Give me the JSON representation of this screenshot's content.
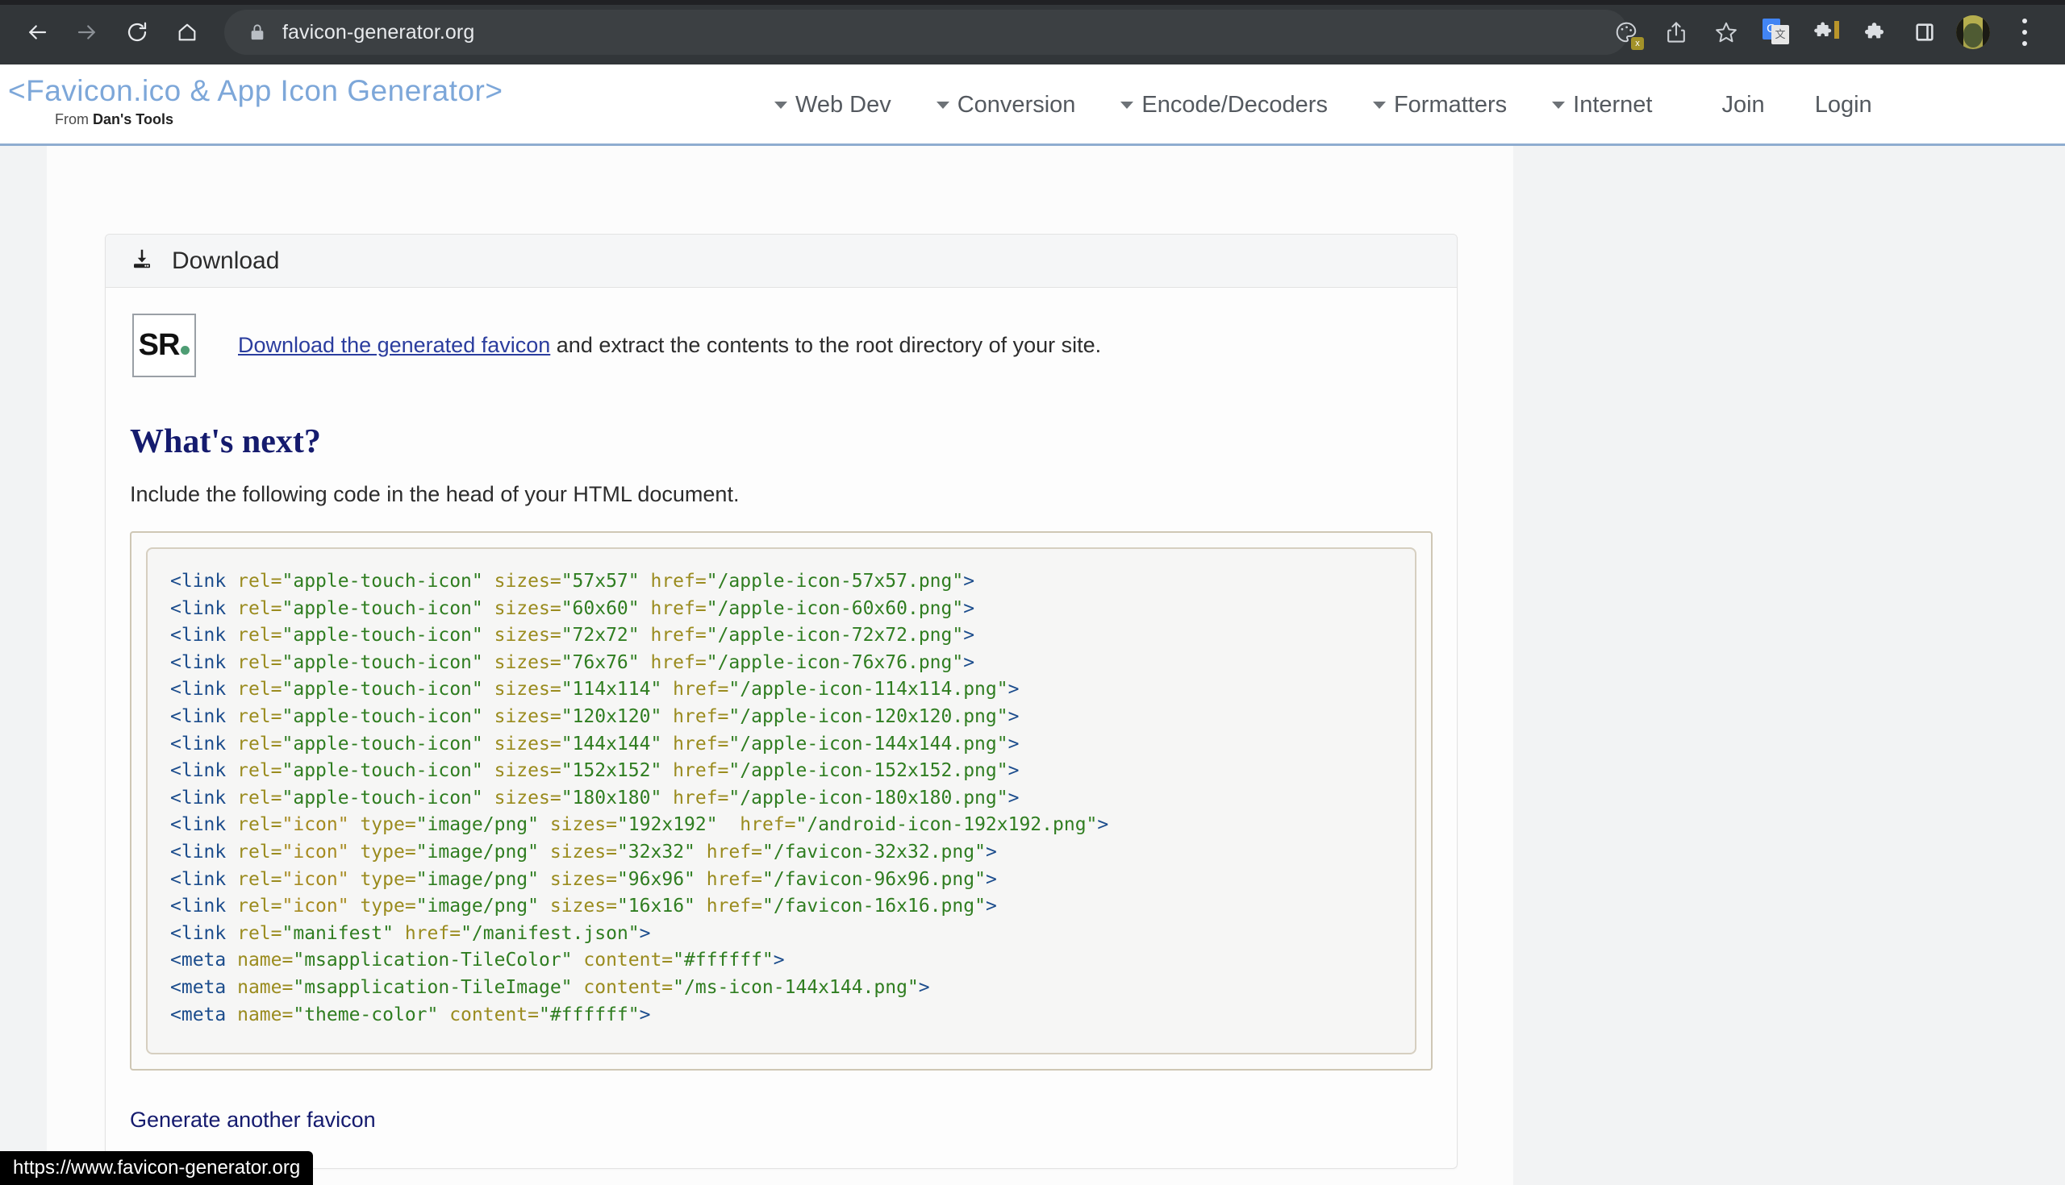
{
  "browser": {
    "url": "favicon-generator.org",
    "back_icon": "back-arrow-icon",
    "forward_icon": "forward-arrow-icon",
    "reload_icon": "reload-icon",
    "home_icon": "home-icon",
    "lock_icon": "lock-icon",
    "actions": [
      "palette-icon",
      "share-icon",
      "bookmark-star-icon",
      "google-translate-icon",
      "extension-puzzle-icon",
      "puzzle-icon",
      "side-panel-icon",
      "avatar",
      "three-dot-menu-icon"
    ]
  },
  "site": {
    "brand_title": "<Favicon.ico & App Icon Generator>",
    "brand_sub_prefix": "From ",
    "brand_sub_strong": "Dan's Tools",
    "nav": [
      {
        "label": "Web Dev",
        "caret": true
      },
      {
        "label": "Conversion",
        "caret": true
      },
      {
        "label": "Encode/Decoders",
        "caret": true
      },
      {
        "label": "Formatters",
        "caret": true
      },
      {
        "label": "Internet",
        "caret": true
      },
      {
        "label": "Join",
        "caret": false
      },
      {
        "label": "Login",
        "caret": false
      }
    ]
  },
  "panel": {
    "header_title": "Download",
    "header_icon": "download-icon",
    "favicon_letters": "SR",
    "download_link_text": "Download the generated favicon",
    "download_rest_text": " and extract the contents to the root directory of your site.",
    "whats_next_heading": "What's next?",
    "include_text": "Include the following code in the head of your HTML document.",
    "generate_another": "Generate another favicon",
    "accent_green": "#4e9d74",
    "link_color": "#2b3d9e"
  },
  "code": {
    "lines": [
      [
        [
          "<link",
          "tag"
        ],
        [
          " rel=",
          "attr"
        ],
        [
          "\"apple-touch-icon\"",
          "val"
        ],
        [
          " sizes=",
          "attr"
        ],
        [
          "\"57x57\"",
          "val"
        ],
        [
          " href=",
          "attr"
        ],
        [
          "\"/apple-icon-57x57.png\"",
          "val"
        ],
        [
          ">",
          "tag"
        ]
      ],
      [
        [
          "<link",
          "tag"
        ],
        [
          " rel=",
          "attr"
        ],
        [
          "\"apple-touch-icon\"",
          "val"
        ],
        [
          " sizes=",
          "attr"
        ],
        [
          "\"60x60\"",
          "val"
        ],
        [
          " href=",
          "attr"
        ],
        [
          "\"/apple-icon-60x60.png\"",
          "val"
        ],
        [
          ">",
          "tag"
        ]
      ],
      [
        [
          "<link",
          "tag"
        ],
        [
          " rel=",
          "attr"
        ],
        [
          "\"apple-touch-icon\"",
          "val"
        ],
        [
          " sizes=",
          "attr"
        ],
        [
          "\"72x72\"",
          "val"
        ],
        [
          " href=",
          "attr"
        ],
        [
          "\"/apple-icon-72x72.png\"",
          "val"
        ],
        [
          ">",
          "tag"
        ]
      ],
      [
        [
          "<link",
          "tag"
        ],
        [
          " rel=",
          "attr"
        ],
        [
          "\"apple-touch-icon\"",
          "val"
        ],
        [
          " sizes=",
          "attr"
        ],
        [
          "\"76x76\"",
          "val"
        ],
        [
          " href=",
          "attr"
        ],
        [
          "\"/apple-icon-76x76.png\"",
          "val"
        ],
        [
          ">",
          "tag"
        ]
      ],
      [
        [
          "<link",
          "tag"
        ],
        [
          " rel=",
          "attr"
        ],
        [
          "\"apple-touch-icon\"",
          "val"
        ],
        [
          " sizes=",
          "attr"
        ],
        [
          "\"114x114\"",
          "val"
        ],
        [
          " href=",
          "attr"
        ],
        [
          "\"/apple-icon-114x114.png\"",
          "val"
        ],
        [
          ">",
          "tag"
        ]
      ],
      [
        [
          "<link",
          "tag"
        ],
        [
          " rel=",
          "attr"
        ],
        [
          "\"apple-touch-icon\"",
          "val"
        ],
        [
          " sizes=",
          "attr"
        ],
        [
          "\"120x120\"",
          "val"
        ],
        [
          " href=",
          "attr"
        ],
        [
          "\"/apple-icon-120x120.png\"",
          "val"
        ],
        [
          ">",
          "tag"
        ]
      ],
      [
        [
          "<link",
          "tag"
        ],
        [
          " rel=",
          "attr"
        ],
        [
          "\"apple-touch-icon\"",
          "val"
        ],
        [
          " sizes=",
          "attr"
        ],
        [
          "\"144x144\"",
          "val"
        ],
        [
          " href=",
          "attr"
        ],
        [
          "\"/apple-icon-144x144.png\"",
          "val"
        ],
        [
          ">",
          "tag"
        ]
      ],
      [
        [
          "<link",
          "tag"
        ],
        [
          " rel=",
          "attr"
        ],
        [
          "\"apple-touch-icon\"",
          "val"
        ],
        [
          " sizes=",
          "attr"
        ],
        [
          "\"152x152\"",
          "val"
        ],
        [
          " href=",
          "attr"
        ],
        [
          "\"/apple-icon-152x152.png\"",
          "val"
        ],
        [
          ">",
          "tag"
        ]
      ],
      [
        [
          "<link",
          "tag"
        ],
        [
          " rel=",
          "attr"
        ],
        [
          "\"apple-touch-icon\"",
          "val"
        ],
        [
          " sizes=",
          "attr"
        ],
        [
          "\"180x180\"",
          "val"
        ],
        [
          " href=",
          "attr"
        ],
        [
          "\"/apple-icon-180x180.png\"",
          "val"
        ],
        [
          ">",
          "tag"
        ]
      ],
      [
        [
          "<link",
          "tag"
        ],
        [
          " rel=",
          "attr"
        ],
        [
          "\"icon\"",
          "val2"
        ],
        [
          " type=",
          "attr"
        ],
        [
          "\"image/png\"",
          "val"
        ],
        [
          " sizes=",
          "attr"
        ],
        [
          "\"192x192\"",
          "val"
        ],
        [
          "  href=",
          "attr"
        ],
        [
          "\"/android-icon-192x192.png\"",
          "val"
        ],
        [
          ">",
          "tag"
        ]
      ],
      [
        [
          "<link",
          "tag"
        ],
        [
          " rel=",
          "attr"
        ],
        [
          "\"icon\"",
          "val2"
        ],
        [
          " type=",
          "attr"
        ],
        [
          "\"image/png\"",
          "val"
        ],
        [
          " sizes=",
          "attr"
        ],
        [
          "\"32x32\"",
          "val"
        ],
        [
          " href=",
          "attr"
        ],
        [
          "\"/favicon-32x32.png\"",
          "val"
        ],
        [
          ">",
          "tag"
        ]
      ],
      [
        [
          "<link",
          "tag"
        ],
        [
          " rel=",
          "attr"
        ],
        [
          "\"icon\"",
          "val2"
        ],
        [
          " type=",
          "attr"
        ],
        [
          "\"image/png\"",
          "val"
        ],
        [
          " sizes=",
          "attr"
        ],
        [
          "\"96x96\"",
          "val"
        ],
        [
          " href=",
          "attr"
        ],
        [
          "\"/favicon-96x96.png\"",
          "val"
        ],
        [
          ">",
          "tag"
        ]
      ],
      [
        [
          "<link",
          "tag"
        ],
        [
          " rel=",
          "attr"
        ],
        [
          "\"icon\"",
          "val2"
        ],
        [
          " type=",
          "attr"
        ],
        [
          "\"image/png\"",
          "val"
        ],
        [
          " sizes=",
          "attr"
        ],
        [
          "\"16x16\"",
          "val"
        ],
        [
          " href=",
          "attr"
        ],
        [
          "\"/favicon-16x16.png\"",
          "val"
        ],
        [
          ">",
          "tag"
        ]
      ],
      [
        [
          "<link",
          "tag"
        ],
        [
          " rel=",
          "attr"
        ],
        [
          "\"manifest\"",
          "val"
        ],
        [
          " href=",
          "attr"
        ],
        [
          "\"/manifest.json\"",
          "val"
        ],
        [
          ">",
          "tag"
        ]
      ],
      [
        [
          "<meta",
          "tag"
        ],
        [
          " name=",
          "attr"
        ],
        [
          "\"msapplication-TileColor\"",
          "val"
        ],
        [
          " content=",
          "attr"
        ],
        [
          "\"#ffffff\"",
          "val"
        ],
        [
          ">",
          "tag"
        ]
      ],
      [
        [
          "<meta",
          "tag"
        ],
        [
          " name=",
          "attr"
        ],
        [
          "\"msapplication-TileImage\"",
          "val"
        ],
        [
          " content=",
          "attr"
        ],
        [
          "\"/ms-icon-144x144.png\"",
          "val"
        ],
        [
          ">",
          "tag"
        ]
      ],
      [
        [
          "<meta",
          "tag"
        ],
        [
          " name=",
          "attr"
        ],
        [
          "\"theme-color\"",
          "val"
        ],
        [
          " content=",
          "attr"
        ],
        [
          "\"#ffffff\"",
          "val"
        ],
        [
          ">",
          "tag"
        ]
      ]
    ]
  },
  "status_bar": {
    "text": "https://www.favicon-generator.org"
  }
}
